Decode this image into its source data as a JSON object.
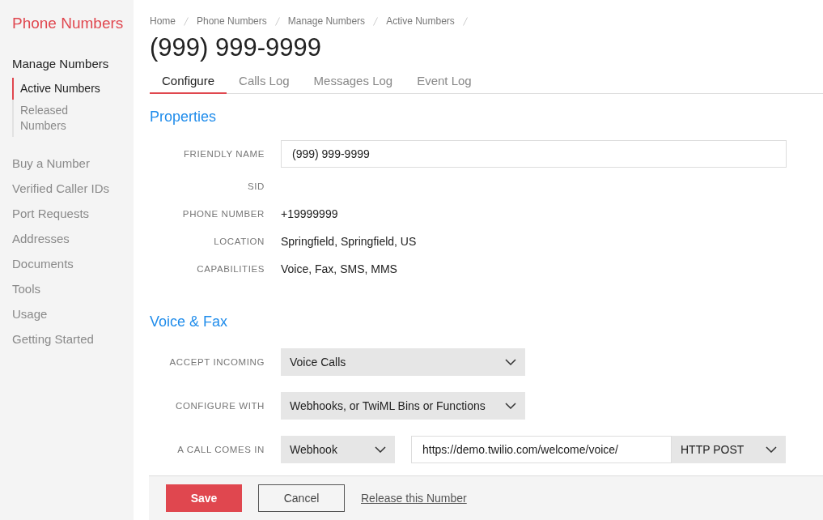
{
  "sidebar": {
    "title": "Phone Numbers",
    "items": [
      {
        "kind": "group",
        "label": "Manage Numbers",
        "children": [
          {
            "label": "Active Numbers",
            "selected": true
          },
          {
            "label": "Released Numbers",
            "selected": false
          }
        ]
      },
      {
        "kind": "link",
        "label": "Buy a Number"
      },
      {
        "kind": "link",
        "label": "Verified Caller IDs"
      },
      {
        "kind": "link",
        "label": "Port Requests"
      },
      {
        "kind": "link",
        "label": "Addresses"
      },
      {
        "kind": "link",
        "label": "Documents"
      },
      {
        "kind": "link",
        "label": "Tools"
      },
      {
        "kind": "link",
        "label": "Usage"
      },
      {
        "kind": "link",
        "label": "Getting Started"
      }
    ]
  },
  "breadcrumb": [
    "Home",
    "Phone Numbers",
    "Manage Numbers",
    "Active Numbers"
  ],
  "title": "(999) 999-9999",
  "tabs": [
    {
      "label": "Configure",
      "selected": true
    },
    {
      "label": "Calls Log",
      "selected": false
    },
    {
      "label": "Messages Log",
      "selected": false
    },
    {
      "label": "Event Log",
      "selected": false
    }
  ],
  "properties": {
    "heading": "Properties",
    "rows": [
      {
        "label": "FRIENDLY NAME",
        "kind": "input",
        "value": "(999) 999-9999"
      },
      {
        "label": "SID",
        "kind": "text"
      },
      {
        "label": "PHONE NUMBER",
        "kind": "text",
        "value": "+19999999"
      },
      {
        "label": "LOCATION",
        "kind": "text",
        "value": "Springfield, Springfield, US"
      },
      {
        "label": "CAPABILITIES",
        "kind": "text",
        "value": "Voice, Fax, SMS, MMS"
      }
    ]
  },
  "voice_fax": {
    "heading": "Voice & Fax",
    "rows": [
      {
        "label": "ACCEPT INCOMING",
        "controls": [
          {
            "kind": "select",
            "value": "Voice Calls"
          }
        ]
      },
      {
        "label": "CONFIGURE WITH",
        "controls": [
          {
            "kind": "select",
            "value": "Webhooks, or TwiML Bins or Functions"
          }
        ]
      },
      {
        "label": "A CALL COMES IN",
        "controls": [
          {
            "kind": "select",
            "value": "Webhook"
          },
          {
            "kind": "input",
            "value": "https://demo.twilio.com/welcome/voice/"
          },
          {
            "kind": "select",
            "value": "HTTP POST"
          }
        ]
      }
    ]
  },
  "footer": {
    "save": "Save",
    "cancel": "Cancel",
    "release": "Release this Number"
  }
}
